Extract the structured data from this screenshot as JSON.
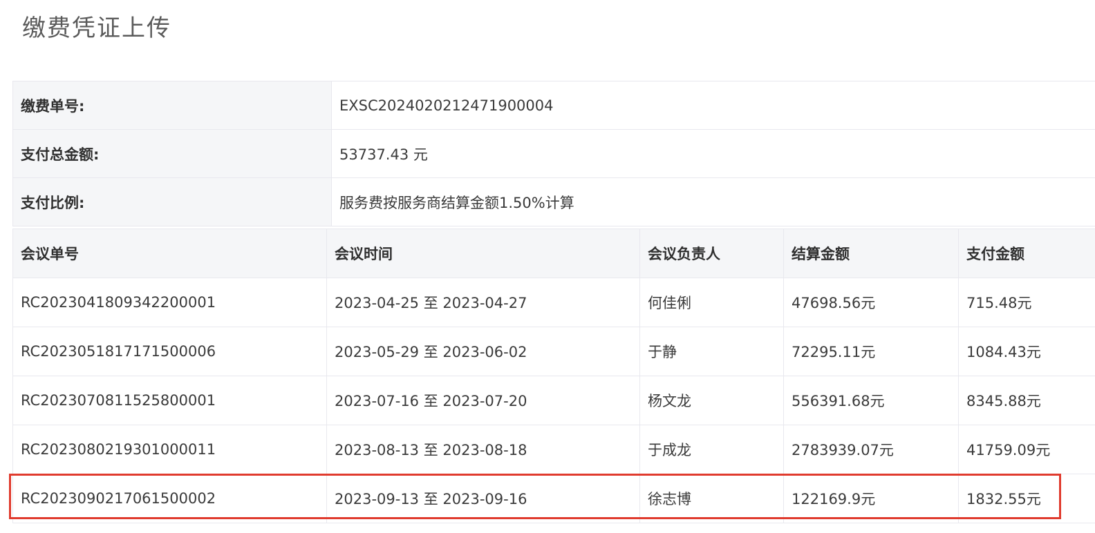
{
  "page": {
    "title": "缴费凭证上传"
  },
  "info": [
    {
      "label": "缴费单号:",
      "value": "EXSC2024020212471900004"
    },
    {
      "label": "支付总金额:",
      "value": "53737.43 元"
    },
    {
      "label": "支付比例:",
      "value": "服务费按服务商结算金额1.50%计算"
    }
  ],
  "table": {
    "headers": [
      "会议单号",
      "会议时间",
      "会议负责人",
      "结算金额",
      "支付金额"
    ],
    "rows": [
      [
        "RC2023041809342200001",
        "2023-04-25 至 2023-04-27",
        "何佳俐",
        "47698.56元",
        "715.48元"
      ],
      [
        "RC2023051817171500006",
        "2023-05-29 至 2023-06-02",
        "于静",
        "72295.11元",
        "1084.43元"
      ],
      [
        "RC2023070811525800001",
        "2023-07-16 至 2023-07-20",
        "杨文龙",
        "556391.68元",
        "8345.88元"
      ],
      [
        "RC2023080219301000011",
        "2023-08-13 至 2023-08-18",
        "于成龙",
        "2783939.07元",
        "41759.09元"
      ],
      [
        "RC2023090217061500002",
        "2023-09-13 至 2023-09-16",
        "徐志博",
        "122169.9元",
        "1832.55元"
      ]
    ]
  },
  "colors": {
    "highlight": "#e03b2e",
    "header_bg": "#f5f6f8",
    "border": "#e8e8ee"
  }
}
